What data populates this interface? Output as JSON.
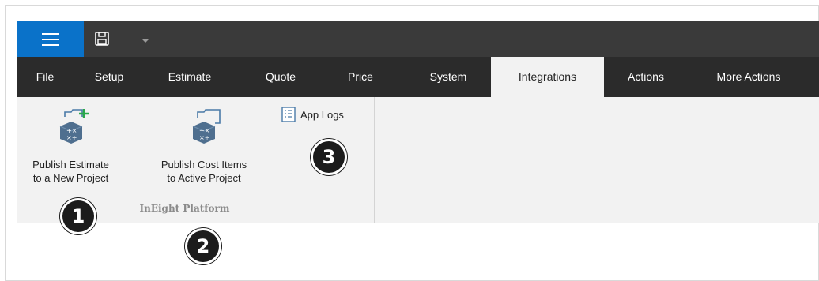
{
  "titlebar": {
    "menu_icon": "hamburger-menu-icon",
    "save_icon": "save-icon",
    "dropdown_icon": "chevron-down-icon",
    "accent_color": "#0a72c9"
  },
  "menu": {
    "tabs": [
      {
        "label": "File"
      },
      {
        "label": "Setup"
      },
      {
        "label": "Estimate"
      },
      {
        "label": "Quote"
      },
      {
        "label": "Price"
      },
      {
        "label": "System"
      },
      {
        "label": "Integrations",
        "active": true
      },
      {
        "label": "Actions"
      },
      {
        "label": "More Actions"
      }
    ]
  },
  "ribbon": {
    "publish_estimate": {
      "line1": "Publish Estimate",
      "line2": "to a New Project",
      "icon": "publish-new-project-icon"
    },
    "publish_cost_items": {
      "line1": "Publish Cost Items",
      "line2": "to Active Project",
      "icon": "publish-active-project-icon"
    },
    "app_logs": {
      "label": "App Logs",
      "icon": "log-document-icon"
    },
    "group_label": "InEight Platform"
  },
  "callouts": [
    "1",
    "2",
    "3"
  ]
}
